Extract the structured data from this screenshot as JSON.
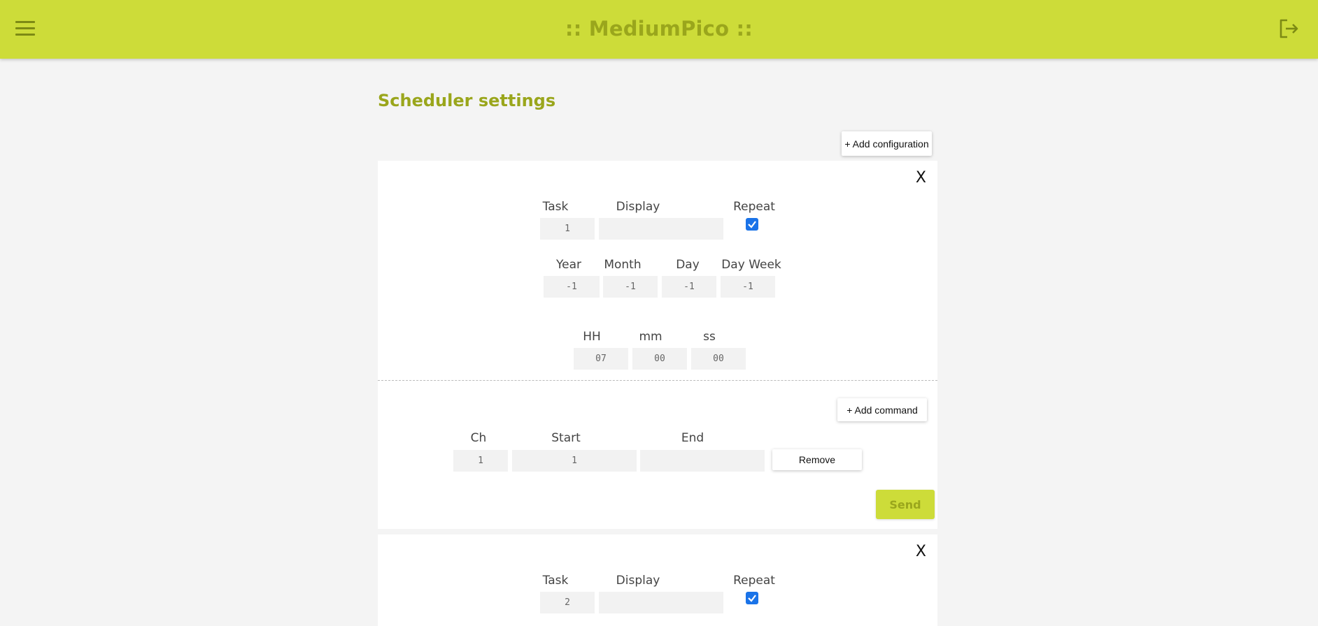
{
  "header": {
    "title": ":: MediumPico ::",
    "menu_icon": "hamburger-menu-icon",
    "logout_icon": "logout-icon",
    "accent_color": "#cddc39",
    "text_accent_color": "#9aa61c"
  },
  "page": {
    "title": "Scheduler settings",
    "add_configuration_label": "+ Add configuration"
  },
  "configurations": [
    {
      "close_label": "X",
      "task_label": "Task",
      "display_label": "Display",
      "repeat_label": "Repeat",
      "task_value": "1",
      "display_value": "",
      "repeat_checked": true,
      "year_label": "Year",
      "month_label": "Month",
      "day_label": "Day",
      "dayweek_label": "Day Week",
      "year_value": "-1",
      "month_value": "-1",
      "day_value": "-1",
      "dayweek_value": "-1",
      "hh_label": "HH",
      "mm_label": "mm",
      "ss_label": "ss",
      "hh_value": "07",
      "mm_value": "00",
      "ss_value": "00",
      "add_command_label": "+ Add command",
      "commands": [
        {
          "ch_label": "Ch",
          "start_label": "Start",
          "end_label": "End",
          "ch_value": "1",
          "start_value": "1",
          "end_value": "",
          "remove_label": "Remove"
        }
      ],
      "send_label": "Send"
    },
    {
      "close_label": "X",
      "task_label": "Task",
      "display_label": "Display",
      "repeat_label": "Repeat",
      "task_value": "2",
      "display_value": "",
      "repeat_checked": true
    }
  ]
}
